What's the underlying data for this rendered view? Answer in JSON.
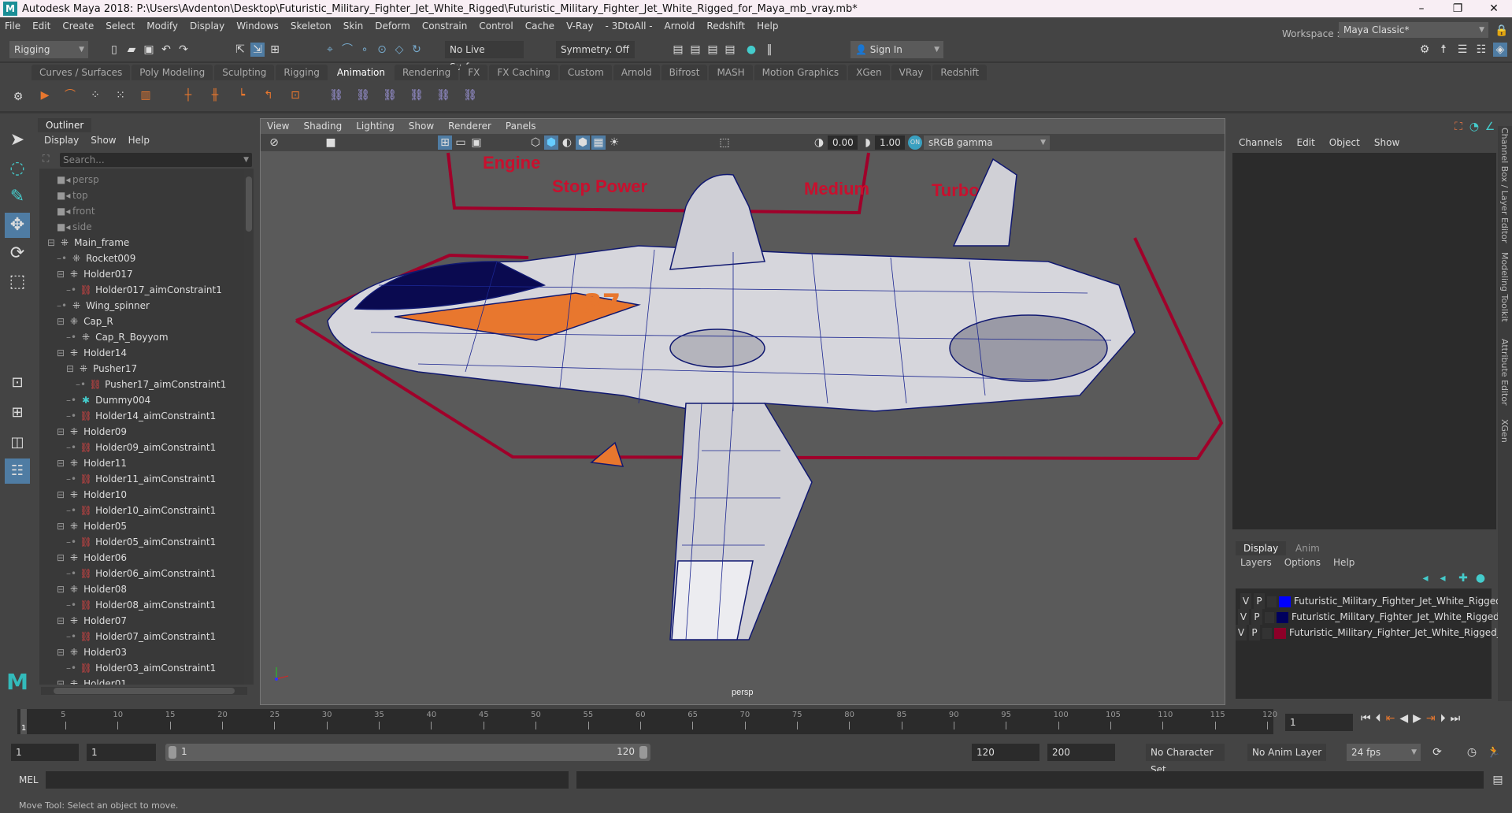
{
  "title": "Autodesk Maya 2018: P:\\Users\\Avdenton\\Desktop\\Futuristic_Military_Fighter_Jet_White_Rigged\\Futuristic_Military_Fighter_Jet_White_Rigged_for_Maya_mb_vray.mb*",
  "menus": [
    "File",
    "Edit",
    "Create",
    "Select",
    "Modify",
    "Display",
    "Windows",
    "Skeleton",
    "Skin",
    "Deform",
    "Constrain",
    "Control",
    "Cache",
    "V-Ray",
    "- 3DtoAll -",
    "Arnold",
    "Redshift",
    "Help"
  ],
  "status": {
    "mode": "Rigging",
    "live_surface": "No Live Surface",
    "symmetry": "Symmetry: Off",
    "sign_in": "Sign In",
    "workspace_label": "Workspace :",
    "workspace": "Maya Classic*"
  },
  "shelf_tabs": [
    "Curves / Surfaces",
    "Poly Modeling",
    "Sculpting",
    "Rigging",
    "Animation",
    "Rendering",
    "FX",
    "FX Caching",
    "Custom",
    "Arnold",
    "Bifrost",
    "MASH",
    "Motion Graphics",
    "XGen",
    "VRay",
    "Redshift"
  ],
  "shelf_active": "Animation",
  "outliner": {
    "tab": "Outliner",
    "menu": [
      "Display",
      "Show",
      "Help"
    ],
    "search_placeholder": "Search...",
    "items": [
      {
        "label": "persp",
        "type": "camera",
        "depth": 1
      },
      {
        "label": "top",
        "type": "camera",
        "depth": 1
      },
      {
        "label": "front",
        "type": "camera",
        "depth": 1
      },
      {
        "label": "side",
        "type": "camera",
        "depth": 1
      },
      {
        "label": "Main_frame",
        "type": "transform",
        "depth": 1,
        "expanded": true
      },
      {
        "label": "Rocket009",
        "type": "transform",
        "depth": 2
      },
      {
        "label": "Holder017",
        "type": "transform",
        "depth": 2,
        "expanded": true
      },
      {
        "label": "Holder017_aimConstraint1",
        "type": "constraint",
        "depth": 3
      },
      {
        "label": "Wing_spinner",
        "type": "transform",
        "depth": 2
      },
      {
        "label": "Cap_R",
        "type": "transform",
        "depth": 2,
        "expanded": true
      },
      {
        "label": "Cap_R_Boyyom",
        "type": "transform",
        "depth": 3
      },
      {
        "label": "Holder14",
        "type": "transform",
        "depth": 2,
        "expanded": true
      },
      {
        "label": "Pusher17",
        "type": "transform",
        "depth": 3,
        "expanded": true
      },
      {
        "label": "Pusher17_aimConstraint1",
        "type": "constraint",
        "depth": 4
      },
      {
        "label": "Dummy004",
        "type": "locator",
        "depth": 3
      },
      {
        "label": "Holder14_aimConstraint1",
        "type": "constraint",
        "depth": 3
      },
      {
        "label": "Holder09",
        "type": "transform",
        "depth": 2,
        "expanded": true
      },
      {
        "label": "Holder09_aimConstraint1",
        "type": "constraint",
        "depth": 3
      },
      {
        "label": "Holder11",
        "type": "transform",
        "depth": 2,
        "expanded": true
      },
      {
        "label": "Holder11_aimConstraint1",
        "type": "constraint",
        "depth": 3
      },
      {
        "label": "Holder10",
        "type": "transform",
        "depth": 2,
        "expanded": true
      },
      {
        "label": "Holder10_aimConstraint1",
        "type": "constraint",
        "depth": 3
      },
      {
        "label": "Holder05",
        "type": "transform",
        "depth": 2,
        "expanded": true
      },
      {
        "label": "Holder05_aimConstraint1",
        "type": "constraint",
        "depth": 3
      },
      {
        "label": "Holder06",
        "type": "transform",
        "depth": 2,
        "expanded": true
      },
      {
        "label": "Holder06_aimConstraint1",
        "type": "constraint",
        "depth": 3
      },
      {
        "label": "Holder08",
        "type": "transform",
        "depth": 2,
        "expanded": true
      },
      {
        "label": "Holder08_aimConstraint1",
        "type": "constraint",
        "depth": 3
      },
      {
        "label": "Holder07",
        "type": "transform",
        "depth": 2,
        "expanded": true
      },
      {
        "label": "Holder07_aimConstraint1",
        "type": "constraint",
        "depth": 3
      },
      {
        "label": "Holder03",
        "type": "transform",
        "depth": 2,
        "expanded": true
      },
      {
        "label": "Holder03_aimConstraint1",
        "type": "constraint",
        "depth": 3
      },
      {
        "label": "Holder01",
        "type": "transform",
        "depth": 2,
        "expanded": true
      }
    ]
  },
  "viewport": {
    "menu": [
      "View",
      "Shading",
      "Lighting",
      "Show",
      "Renderer",
      "Panels"
    ],
    "exposure": "0.00",
    "gamma": "1.00",
    "color_space": "sRGB gamma",
    "camera": "persp",
    "scene_labels": [
      "Engine",
      "Stop Power",
      "Medium",
      "Turbo"
    ],
    "decal": "37"
  },
  "channel_box": {
    "menu": [
      "Channels",
      "Edit",
      "Object",
      "Show"
    ]
  },
  "side_tabs": [
    "Channel Box / Layer Editor",
    "Modeling Toolkit",
    "Attribute Editor",
    "XGen"
  ],
  "layer_editor": {
    "tabs": [
      "Display",
      "Anim"
    ],
    "menu": [
      "Layers",
      "Options",
      "Help"
    ],
    "layers": [
      {
        "v": "V",
        "p": "P",
        "color": "#0000ff",
        "name": "Futuristic_Military_Fighter_Jet_White_Rigged_Hel"
      },
      {
        "v": "V",
        "p": "P",
        "color": "#00005e",
        "name": "Futuristic_Military_Fighter_Jet_White_Rigged_Geom"
      },
      {
        "v": "V",
        "p": "P",
        "color": "#8c0028",
        "name": "Futuristic_Military_Fighter_Jet_White_Rigged_Contro"
      }
    ]
  },
  "timeline": {
    "start": 1,
    "end": 120,
    "current": "1",
    "label_step": 5,
    "current_field": "1"
  },
  "range": {
    "start_field": "1",
    "playback_start": "1",
    "slider_start": "1",
    "slider_end": "120",
    "playback_end": "120",
    "end_field": "200",
    "character_set": "No Character Set",
    "anim_layer": "No Anim Layer",
    "fps": "24 fps"
  },
  "mel": {
    "label": "MEL"
  },
  "help_line": "Move Tool: Select an object to move."
}
